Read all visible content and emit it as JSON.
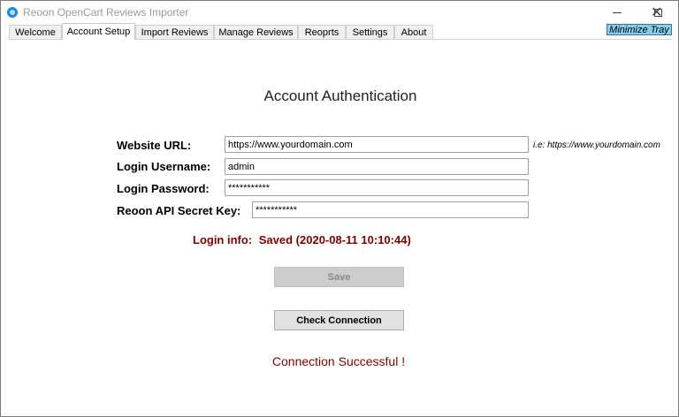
{
  "window": {
    "title": "Reoon OpenCart Reviews Importer",
    "minimize_icon": "minimize-icon",
    "maximize_icon": "maximize-icon",
    "close_icon": "close-icon",
    "close_glyph": "✕"
  },
  "tabs": {
    "welcome": "Welcome",
    "account_setup": "Account Setup",
    "import_reviews": "Import Reviews",
    "manage_reviews": "Manage Reviews",
    "reports": "Reoprts",
    "settings": "Settings",
    "about": "About",
    "active": "Account Setup"
  },
  "minimize_tray_label": "Minimize Tray",
  "form": {
    "heading": "Account Authentication",
    "url_label": "Website URL:",
    "url_value": "https://www.yourdomain.com",
    "url_hint": "i.e: https://www.yourdomain.com",
    "username_label": "Login Username:",
    "username_value": "admin",
    "password_label": "Login Password:",
    "password_value": "***********",
    "api_label": "Reoon API Secret Key:",
    "api_value": "***********"
  },
  "login_info": {
    "label": "Login info:",
    "value": "Saved (2020-08-11 10:10:44)"
  },
  "buttons": {
    "save": "Save",
    "check_connection": "Check Connection"
  },
  "status_message": "Connection Successful !",
  "colors": {
    "status_text": "#800000",
    "tray_button": "#87ceeb",
    "app_icon": "#1e88e5"
  }
}
